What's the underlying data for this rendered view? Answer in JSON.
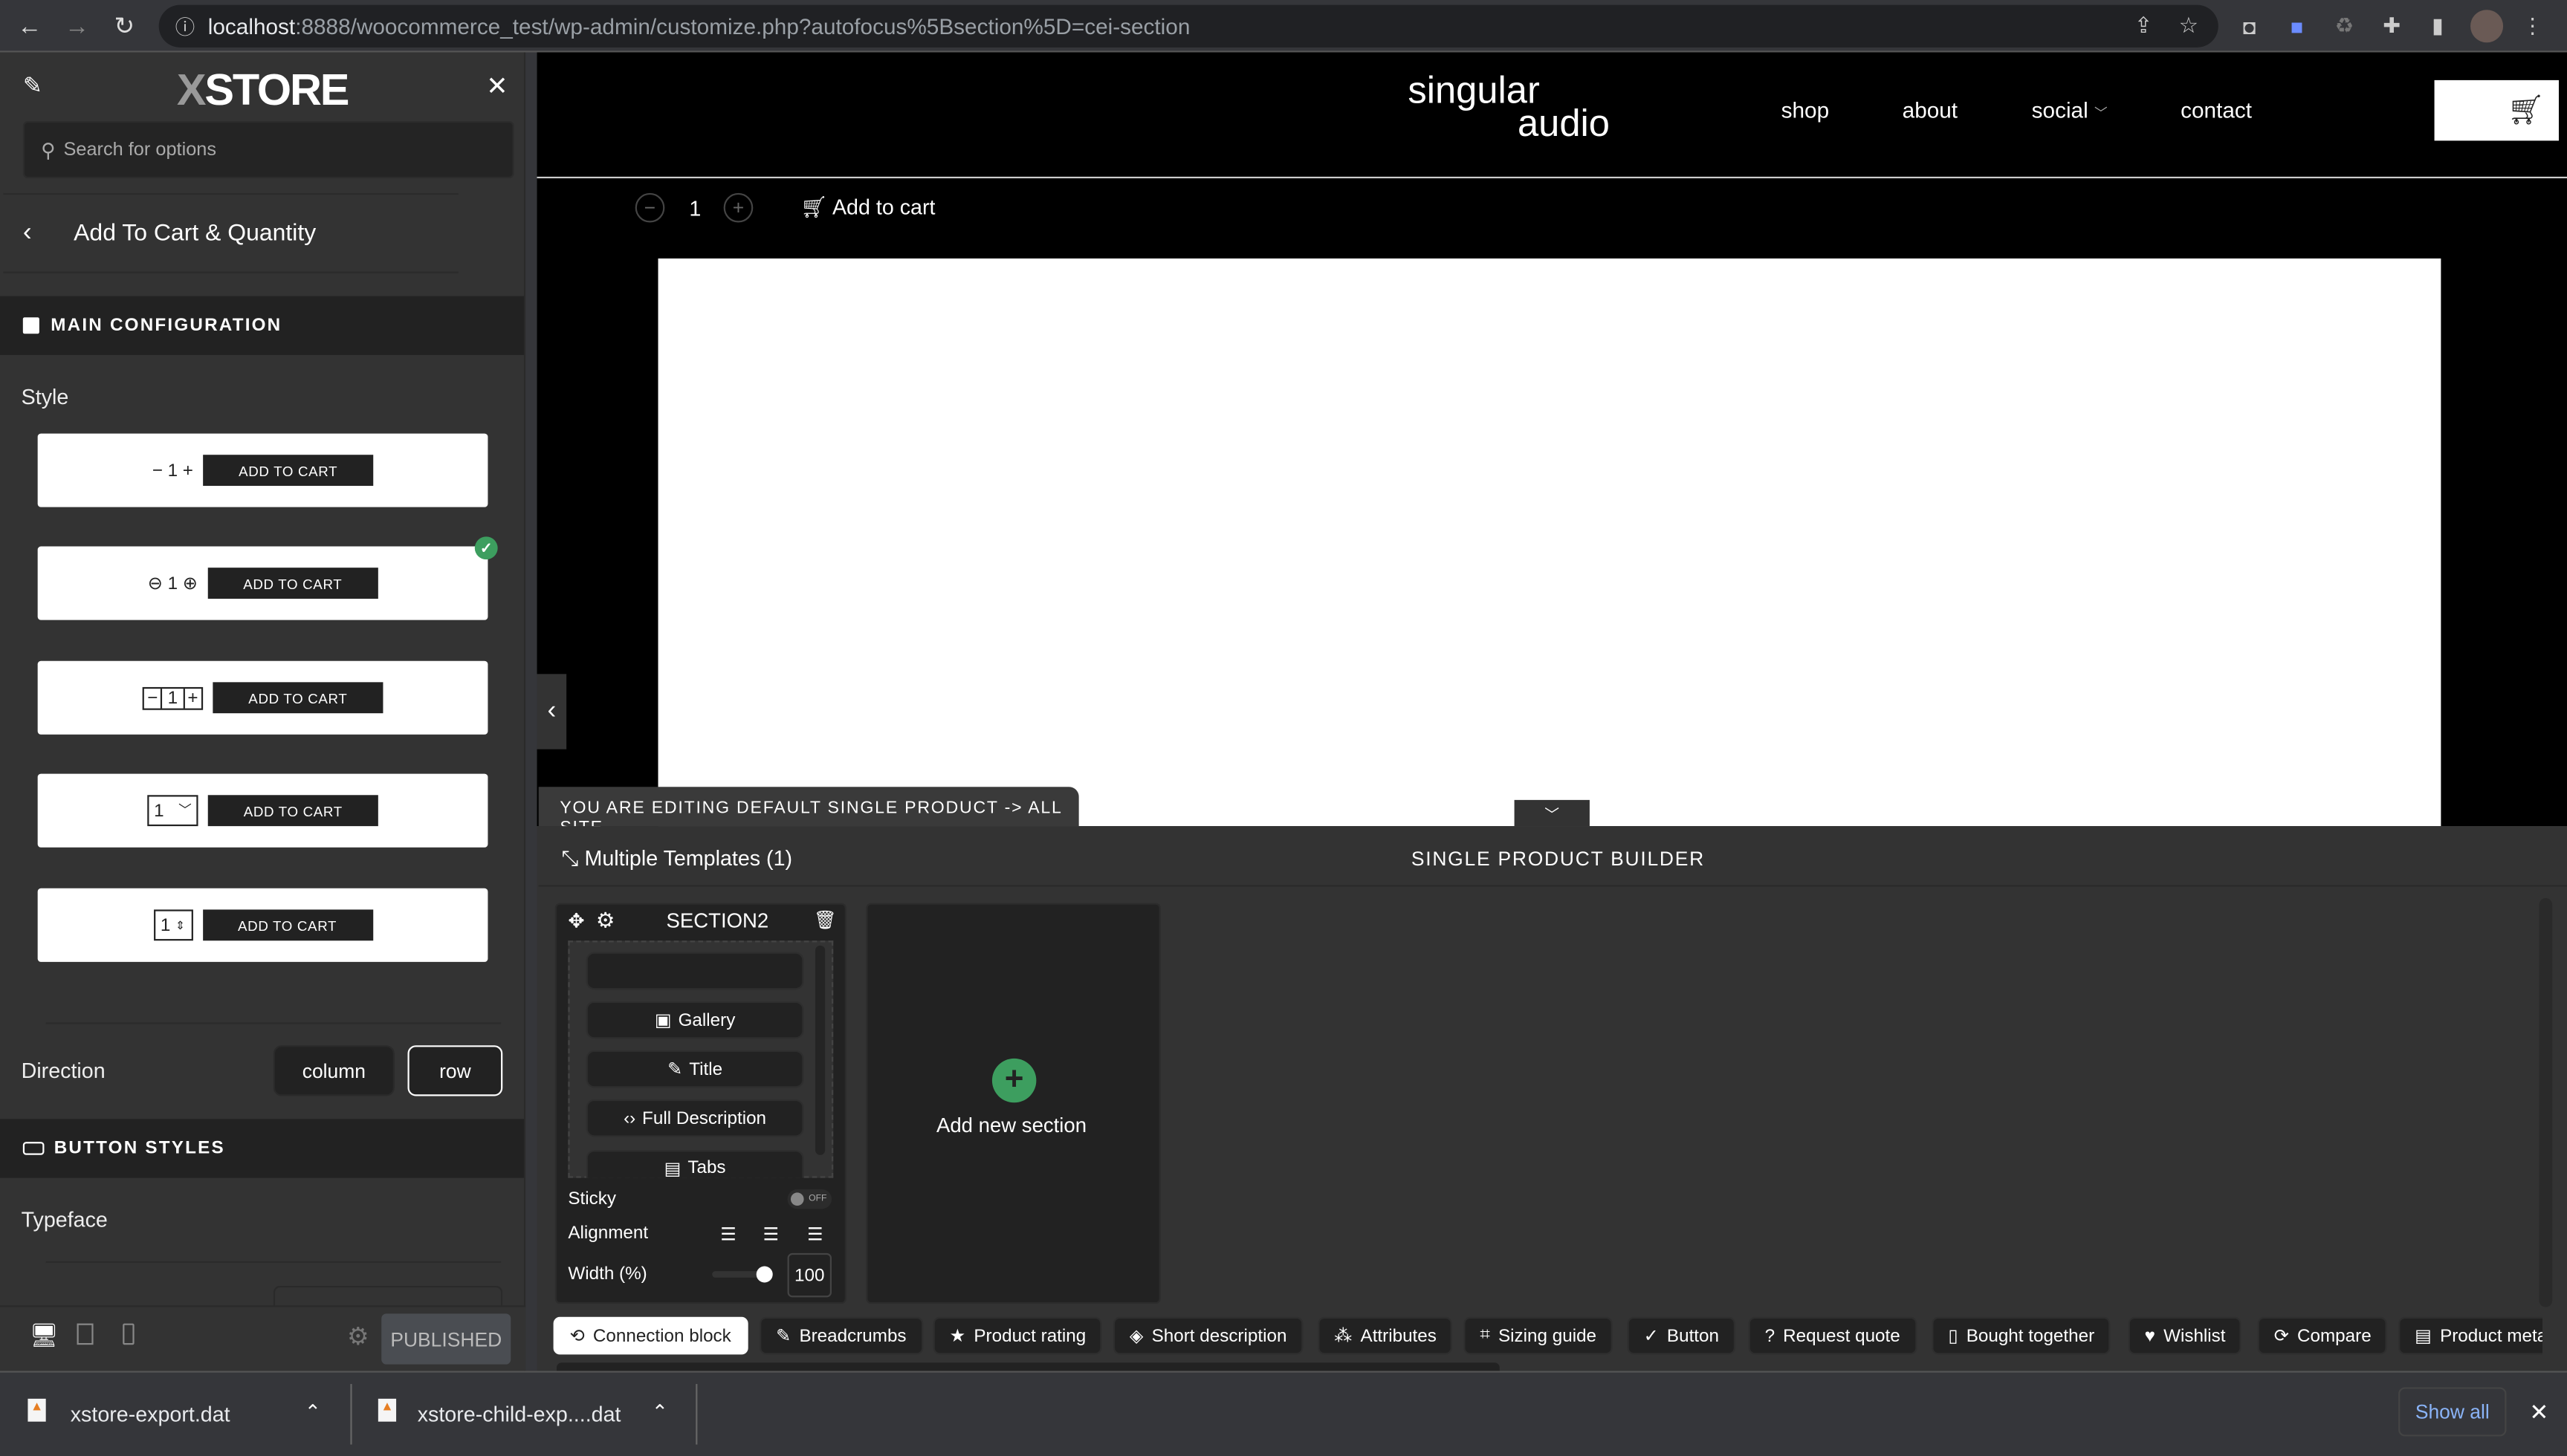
{
  "browser": {
    "url_host": "localhost",
    "url_rest": ":8888/woocommerce_test/wp-admin/customize.php?autofocus%5Bsection%5D=cei-section",
    "icons": [
      "back-icon",
      "forward-icon",
      "reload-icon",
      "info-icon",
      "share-icon",
      "star-icon",
      "extension-icon",
      "puzzle-icon",
      "sidepanel-icon",
      "profile-avatar",
      "menu-icon"
    ]
  },
  "sidebar": {
    "logo_x": "X",
    "logo_rest": "STORE",
    "search_placeholder": "Search for options",
    "back_title": "Add To Cart & Quantity",
    "main_config": "MAIN CONFIGURATION",
    "style_label": "Style",
    "style_options": [
      {
        "qty": "1",
        "button": "ADD TO CART",
        "type": "plain"
      },
      {
        "qty": "1",
        "button": "ADD TO CART",
        "type": "circle",
        "selected": true
      },
      {
        "qty": "1",
        "button": "ADD TO CART",
        "type": "boxed"
      },
      {
        "qty": "1",
        "button": "ADD TO CART",
        "type": "select"
      },
      {
        "qty": "1",
        "button": "ADD TO CART",
        "type": "spinner"
      }
    ],
    "direction_label": "Direction",
    "direction_options": [
      "column",
      "row"
    ],
    "direction_selected": "row",
    "button_styles": "BUTTON STYLES",
    "typeface_label": "Typeface",
    "publish_label": "PUBLISHED",
    "accent_check": "#3d9e5f"
  },
  "preview": {
    "logo_line1": "singular",
    "logo_line2": "audio",
    "menu": [
      "shop",
      "about",
      "social",
      "contact"
    ],
    "qty": "1",
    "add_to_cart": "Add to cart",
    "editing_banner": "YOU ARE EDITING DEFAULT SINGLE PRODUCT -> ALL SITE"
  },
  "builder": {
    "templates_label": "Multiple Templates (1)",
    "title": "SINGLE PRODUCT BUILDER",
    "section": {
      "name": "SECTION2",
      "elements": [
        "",
        "Gallery",
        "Title",
        "Full Description",
        "Tabs"
      ],
      "sticky_label": "Sticky",
      "sticky_state": "OFF",
      "alignment_label": "Alignment",
      "width_label": "Width (%)",
      "width_value": "100"
    },
    "add_section": "Add new section",
    "chips": [
      "Connection block",
      "Breadcrumbs",
      "Product rating",
      "Short description",
      "Attributes",
      "Sizing guide",
      "Button",
      "Request quote",
      "Bought together",
      "Wishlist",
      "Compare",
      "Product meta"
    ]
  },
  "downloads": {
    "files": [
      "xstore-export.dat",
      "xstore-child-exp....dat"
    ],
    "show_all": "Show all"
  }
}
